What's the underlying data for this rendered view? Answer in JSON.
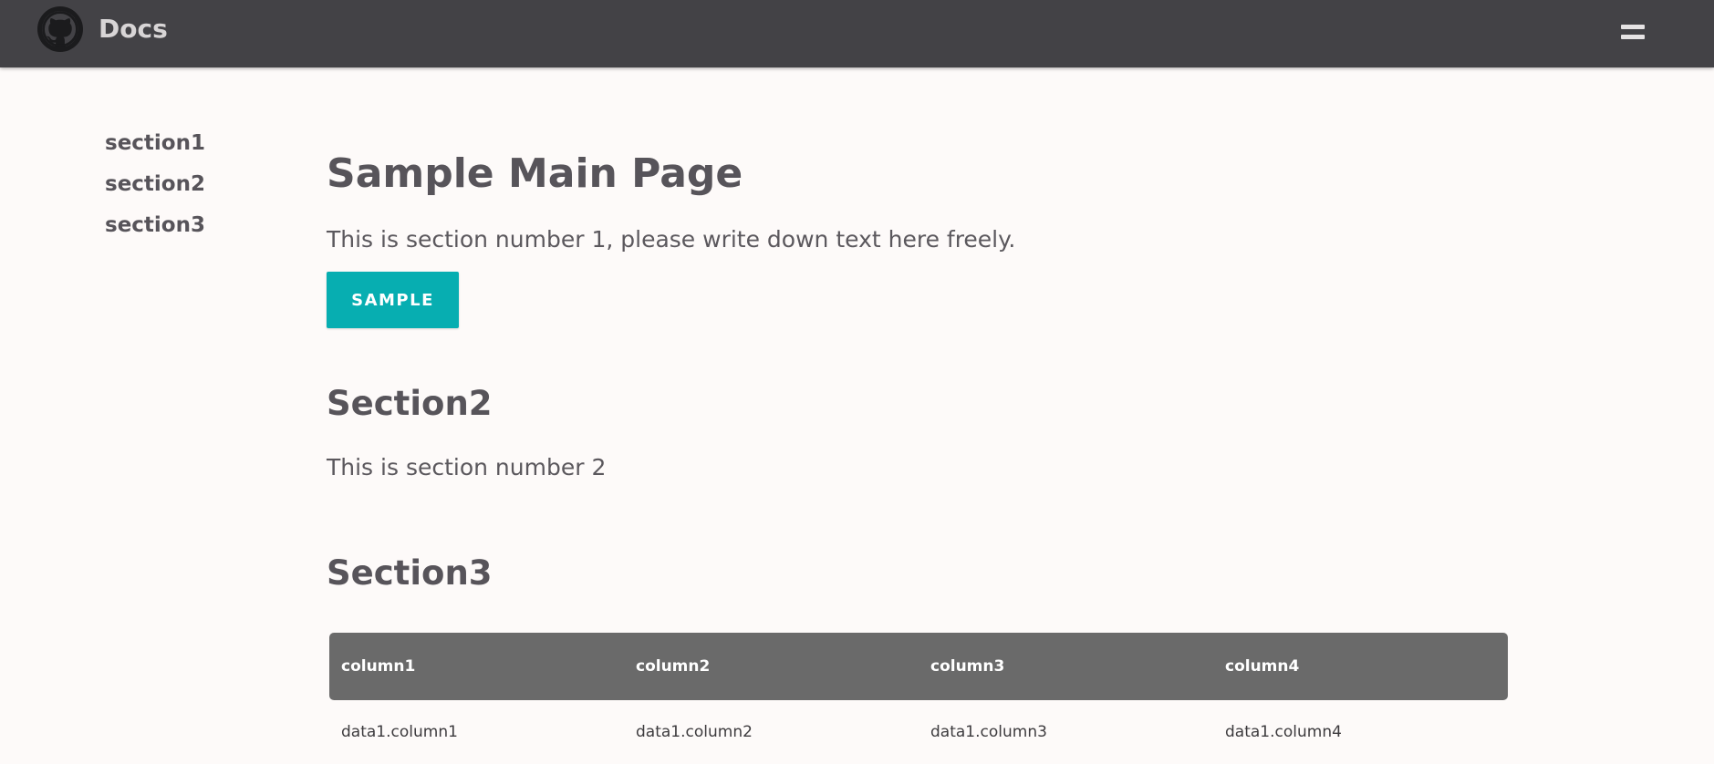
{
  "header": {
    "brand": "Docs",
    "logo_icon": "github-icon",
    "menu_icon": "hamburger-menu-icon",
    "background": "#434246"
  },
  "sidebar": {
    "items": [
      {
        "label": "section1"
      },
      {
        "label": "section2"
      },
      {
        "label": "section3"
      }
    ]
  },
  "main": {
    "title": "Sample Main Page",
    "section1_text": "This is section number 1, please write down text here freely.",
    "sample_button": "SAMPLE",
    "accent": "#07aeb1",
    "section2_title": "Section2",
    "section2_text": "This is section number 2",
    "section3_title": "Section3",
    "table": {
      "headers": [
        "column1",
        "column2",
        "column3",
        "column4"
      ],
      "rows": [
        [
          "data1.column1",
          "data1.column2",
          "data1.column3",
          "data1.column4"
        ]
      ]
    }
  }
}
